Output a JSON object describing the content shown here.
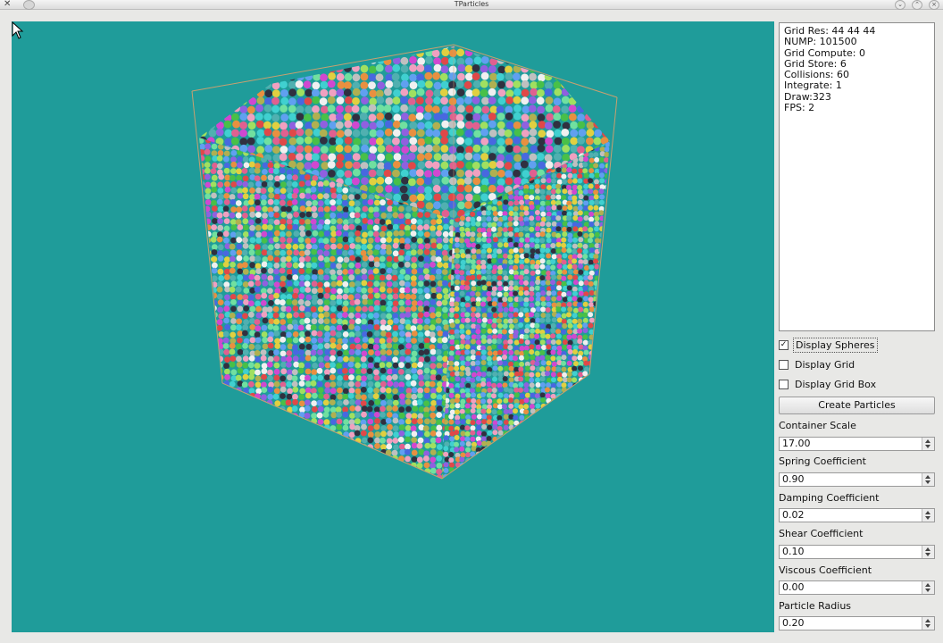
{
  "window": {
    "title": "TParticles"
  },
  "colors": {
    "viewport_bg": "#1f9c9a",
    "box_edge": "#c8a070"
  },
  "stats": {
    "lines": [
      "Grid Res: 44 44 44",
      "NUMP: 101500",
      "Grid Compute: 0",
      "Grid Store: 6",
      "Collisions: 60",
      "Integrate: 1",
      "Draw:323",
      "FPS: 2"
    ]
  },
  "options": [
    {
      "label": "Display Spheres",
      "checked": true
    },
    {
      "label": "Display Grid",
      "checked": false
    },
    {
      "label": "Display Grid Box",
      "checked": false
    }
  ],
  "create_button": "Create Particles",
  "params": [
    {
      "label": "Container Scale",
      "value": "17.00"
    },
    {
      "label": "Spring Coefficient",
      "value": "0.90"
    },
    {
      "label": "Damping Coefficient",
      "value": "0.02"
    },
    {
      "label": "Shear Coefficient",
      "value": "0.10"
    },
    {
      "label": "Viscous Coefficient",
      "value": "0.00"
    },
    {
      "label": "Particle Radius",
      "value": "0.20"
    }
  ]
}
